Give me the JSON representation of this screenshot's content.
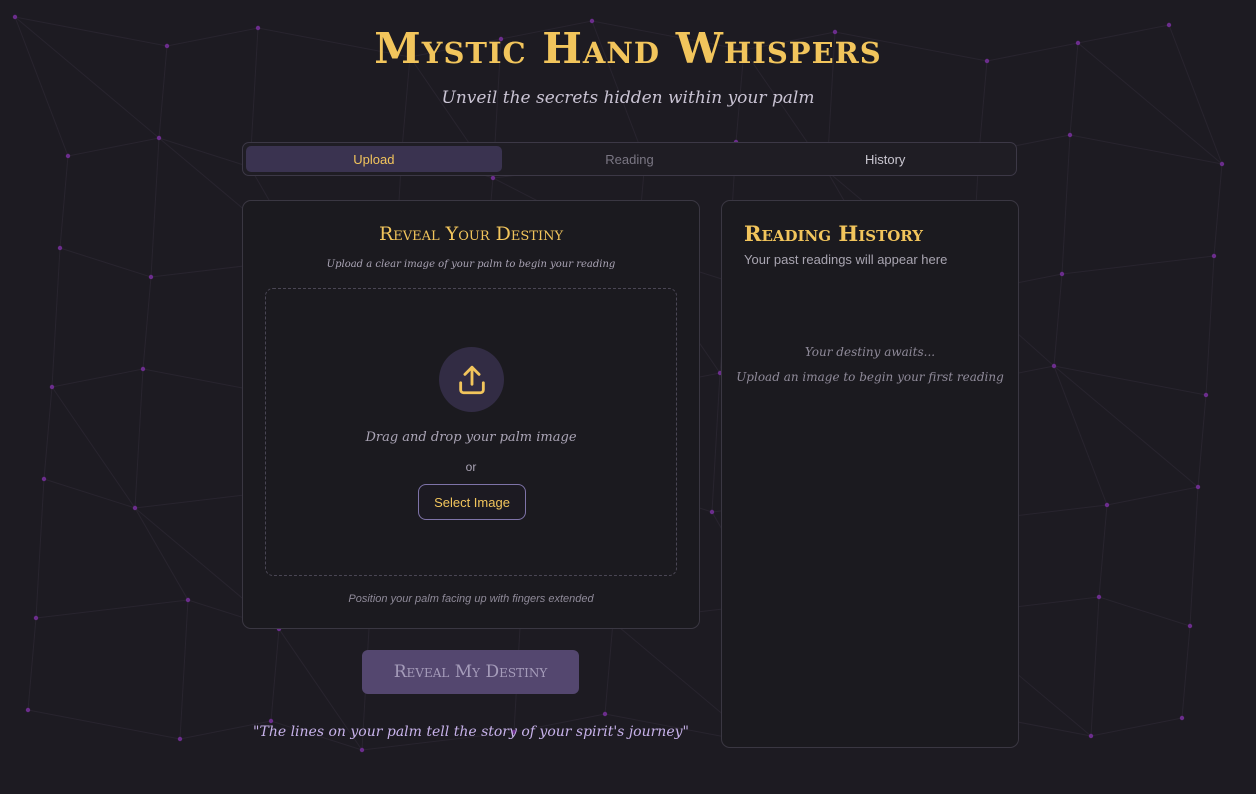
{
  "header": {
    "title": "Mystic Hand Whispers",
    "subtitle": "Unveil the secrets hidden within your palm"
  },
  "tabs": [
    {
      "label": "Upload",
      "state": "active"
    },
    {
      "label": "Reading",
      "state": "disabled"
    },
    {
      "label": "History",
      "state": "normal"
    }
  ],
  "upload": {
    "title": "Reveal Your Destiny",
    "subtitle": "Upload a clear image of your palm to begin your reading",
    "icon": "upload-icon",
    "drag_text": "Drag and drop your palm image",
    "or_text": "or",
    "select_button": "Select Image",
    "hint": "Position your palm facing up with fingers extended"
  },
  "reveal_button": "Reveal My Destiny",
  "quote": "\"The lines on your palm tell the story of your spirit's journey\"",
  "history": {
    "title": "Reading History",
    "subtitle": "Your past readings will appear here",
    "empty_line1": "Your destiny awaits...",
    "empty_line2": "Upload an image to begin your first reading"
  },
  "colors": {
    "background": "#1d1b22",
    "accent_gold": "#f2c55c",
    "accent_purple": "#54476f",
    "star_dots": "#6b2d8c"
  }
}
